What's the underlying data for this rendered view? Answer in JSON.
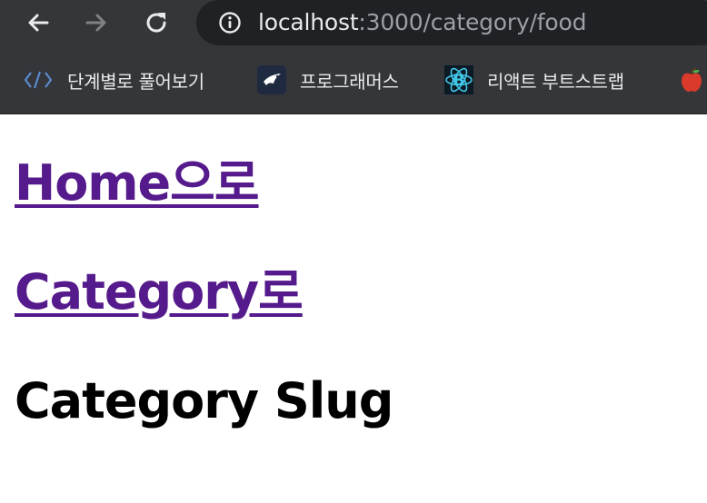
{
  "browser": {
    "url_host": "localhost",
    "url_rest": ":3000/category/food",
    "colors": {
      "chrome_bg": "#35363a",
      "omnibox_bg": "#202124",
      "link_visited": "#551a8b"
    }
  },
  "bookmarks": [
    {
      "label": "단계별로 풀어보기",
      "icon": "code-brackets-icon"
    },
    {
      "label": "프로그래머스",
      "icon": "programmers-bird-icon"
    },
    {
      "label": "리액트 부트스트랩",
      "icon": "react-bootstrap-icon"
    }
  ],
  "page": {
    "home_link": "Home으로",
    "category_link": "Category로",
    "heading": "Category Slug"
  }
}
